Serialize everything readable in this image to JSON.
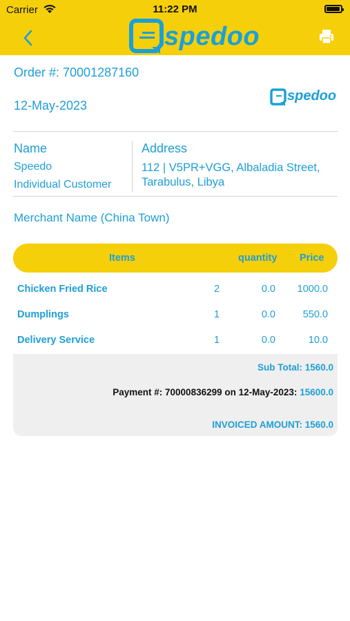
{
  "status_bar": {
    "carrier": "Carrier",
    "time": "11:22 PM",
    "battery_level": 0.95
  },
  "nav": {
    "brand": "spedoo",
    "back_icon": "chevron-left-icon",
    "print_icon": "printer-icon"
  },
  "order": {
    "number_text": "Order #: 70001287160",
    "date": "12-May-2023",
    "logo_text": "spedoo"
  },
  "customer": {
    "name_label": "Name",
    "name": "Speedo",
    "type": "Individual Customer",
    "address_label": "Address",
    "address": "112 | V5PR+VGG, Albaladia Street, Tarabulus, Libya"
  },
  "merchant": "Merchant Name (China Town)",
  "items_table": {
    "headers": {
      "items": "Items",
      "quantity": "quantity",
      "price": "Price"
    },
    "rows": [
      {
        "name": "Chicken Fried Rice",
        "qty": "2",
        "price": "0.0",
        "total": "1000.0"
      },
      {
        "name": "Dumplings",
        "qty": "1",
        "price": "0.0",
        "total": "550.0"
      },
      {
        "name": "Delivery Service",
        "qty": "1",
        "price": "0.0",
        "total": "10.0"
      }
    ]
  },
  "summary": {
    "subtotal": "Sub Total: 1560.0",
    "payment_text": "Payment #: 70000836299 on 12-May-2023:",
    "payment_amount": "15600.0",
    "invoiced": "INVOICED AMOUNT: 1560.0"
  },
  "colors": {
    "brand_yellow": "#F5CF0A",
    "brand_blue": "#1E9ED6",
    "summary_bg": "#EFEFEF"
  }
}
